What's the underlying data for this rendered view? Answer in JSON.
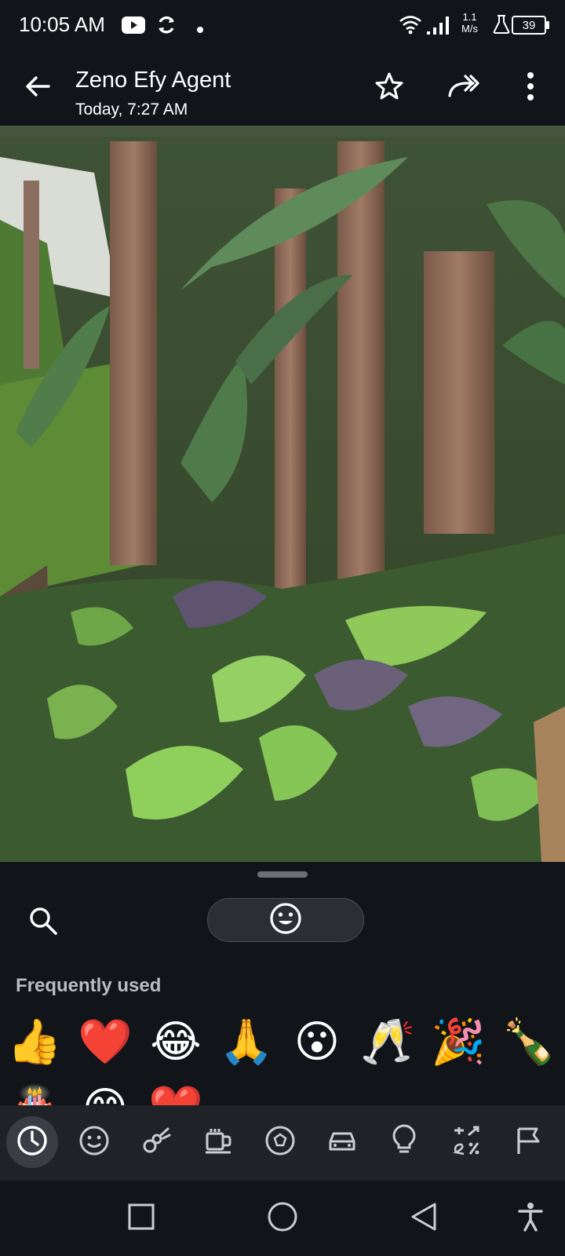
{
  "status_bar": {
    "time": "10:05 AM",
    "speed_value": "1.1",
    "speed_unit": "M/s",
    "battery": "39",
    "icons": [
      "youtube-icon",
      "sync-icon",
      "dot-icon",
      "wifi-icon",
      "signal-icon",
      "flask-icon",
      "battery-icon"
    ]
  },
  "toolbar": {
    "title": "Zeno Efy Agent",
    "subtitle": "Today, 7:27 AM",
    "icons": [
      "back-arrow-icon",
      "star-icon",
      "forward-icon",
      "more-vert-icon"
    ]
  },
  "photo": {
    "description_icon": "photo"
  },
  "emoji_panel": {
    "frequently_used_label": "Frequently used",
    "row1": [
      "👍",
      "❤️",
      "😂",
      "🙏",
      "😮",
      "🥂",
      "🎉",
      "🍾"
    ],
    "row2": [
      "🎂",
      "😊",
      "❤️"
    ],
    "icons": [
      "search-icon",
      "smiley-icon"
    ]
  },
  "categories": [
    "recent-icon",
    "smileys-icon",
    "animals-icon",
    "food-icon",
    "activities-icon",
    "travel-icon",
    "objects-icon",
    "symbols-icon",
    "flags-icon"
  ],
  "colors": {
    "background": "#111419",
    "panel": "#1f2328",
    "pill": "#2b2f35",
    "text_secondary": "#b9bcc0"
  }
}
